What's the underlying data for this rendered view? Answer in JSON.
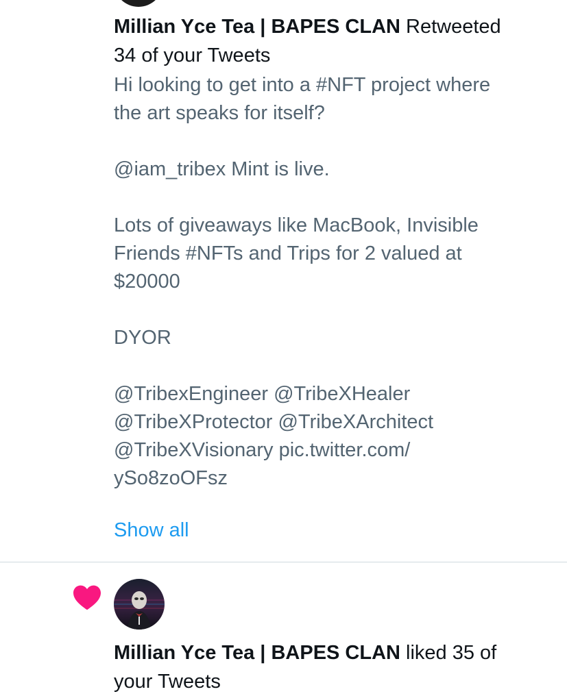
{
  "retweet_notification": {
    "user_name": "Millian Yce Tea | BAPES CLAN",
    "action_line_1": " Retweeted",
    "action_line_2": "34 of your Tweets",
    "tweet_lines": [
      "Hi looking to get into a #NFT project where",
      "the art speaks for itself?",
      "",
      "@iam_tribex Mint is live.",
      "",
      "Lots of giveaways like MacBook, Invisible",
      "Friends #NFTs and Trips for 2 valued at",
      "$20000",
      "",
      "DYOR",
      "",
      "@TribexEngineer @TribeXHealer",
      "@TribeXProtector @TribeXArchitect",
      "@TribeXVisionary pic.twitter.com/",
      "ySo8zoOFsz"
    ],
    "show_all_label": "Show all"
  },
  "like_notification": {
    "icon": "heart-icon",
    "icon_color": "#f91880",
    "user_name": "Millian Yce Tea | BAPES CLAN",
    "action_line_1": " liked 35 of",
    "action_line_2": "your Tweets"
  },
  "colors": {
    "primary_text": "#0f1419",
    "secondary_text": "#536471",
    "link": "#1d9bf0",
    "divider": "#cfd9de"
  }
}
